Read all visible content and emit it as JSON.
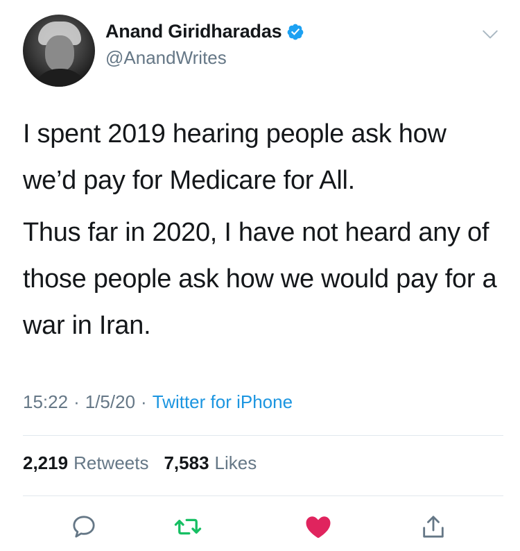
{
  "author": {
    "display_name": "Anand Giridharadas",
    "handle": "@AnandWrites",
    "verified": true
  },
  "tweet": {
    "paragraphs": [
      "I spent 2019 hearing people ask how we’d pay for Medicare for All.",
      "Thus far in 2020, I have not heard any of those people ask how we would pay for a war in Iran."
    ],
    "time": "15:22",
    "separator": "·",
    "date": "1/5/20",
    "source": "Twitter for iPhone"
  },
  "stats": {
    "retweets_count": "2,219",
    "retweets_label": "Retweets",
    "likes_count": "7,583",
    "likes_label": "Likes"
  },
  "colors": {
    "verified_blue": "#1da1f2",
    "link_blue": "#1b95e0",
    "secondary_text": "#657786",
    "retweet_green": "#17bf63",
    "like_red": "#e0245e"
  },
  "icons": {
    "reply": "reply-icon",
    "retweet": "retweet-icon",
    "like": "heart-icon",
    "share": "share-icon",
    "menu": "chevron-down-icon"
  }
}
